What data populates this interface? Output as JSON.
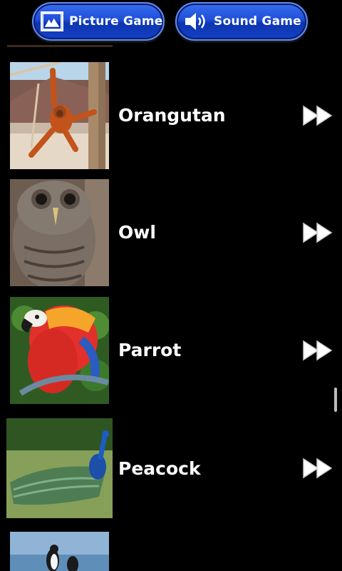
{
  "topbar": {
    "picture_game_label": "Picture Game",
    "sound_game_label": "Sound Game"
  },
  "animals": [
    {
      "name": "Orangutan",
      "icon": "fast-forward-icon"
    },
    {
      "name": "Owl",
      "icon": "fast-forward-icon"
    },
    {
      "name": "Parrot",
      "icon": "fast-forward-icon"
    },
    {
      "name": "Peacock",
      "icon": "fast-forward-icon"
    }
  ],
  "colors": {
    "background": "#000000",
    "button_blue": "#1e4fd8",
    "text": "#ffffff"
  }
}
